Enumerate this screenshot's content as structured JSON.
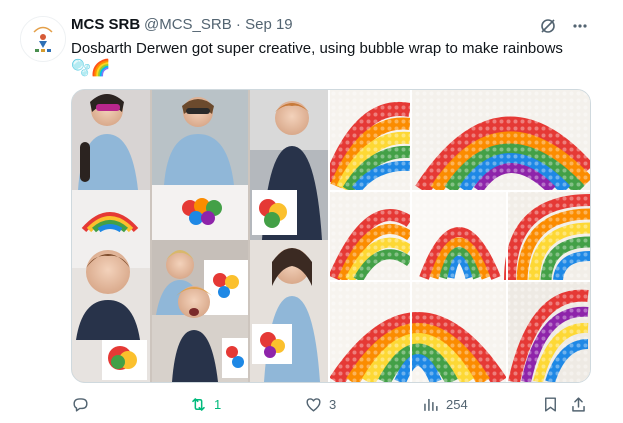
{
  "tweet": {
    "display_name": "MCS SRB",
    "handle": "@MCS_SRB",
    "separator": "·",
    "date": "Sep 19",
    "text": "Dosbarth Derwen got super creative, using bubble wrap to make rainbows",
    "emoji": "🫧🌈"
  },
  "icons": {
    "grok": "grok-icon",
    "more": "more-icon",
    "reply": "reply-icon",
    "repost": "repost-icon",
    "like": "like-icon",
    "views": "views-icon",
    "bookmark": "bookmark-icon",
    "share": "share-icon"
  },
  "actions": {
    "reposts": "1",
    "likes": "3",
    "views": "254"
  },
  "colors": {
    "repost_active": "#00ba7c",
    "muted": "#536471"
  }
}
